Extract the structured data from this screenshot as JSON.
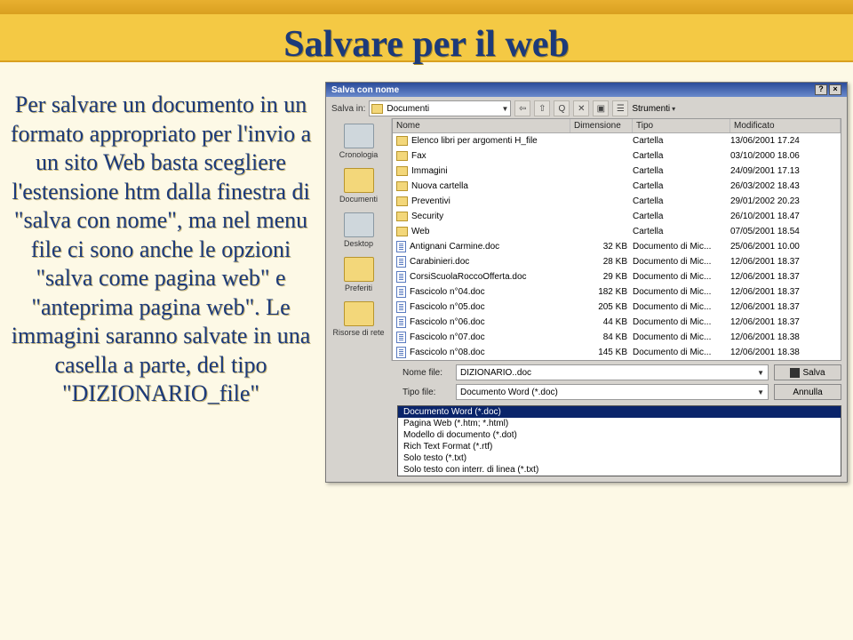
{
  "slide": {
    "title": "Salvare per il web",
    "body": "Per salvare un documento in un formato appropriato per l'invio a un sito Web basta scegliere l'estensione htm dalla finestra di \"salva con nome\", ma nel menu file ci sono anche le opzioni \"salva come pagina web\" e \"anteprima pagina web\". Le immagini saranno salvate in una casella a parte, del tipo \"DIZIONARIO_file\""
  },
  "dialog": {
    "title": "Salva con nome",
    "salva_in_label": "Salva in:",
    "salva_in_value": "Documenti",
    "strumenti": "Strumenti",
    "places": [
      {
        "name": "cronologia",
        "label": "Cronologia",
        "gray": true
      },
      {
        "name": "documenti",
        "label": "Documenti"
      },
      {
        "name": "desktop",
        "label": "Desktop",
        "gray": true
      },
      {
        "name": "preferiti",
        "label": "Preferiti"
      },
      {
        "name": "risorse",
        "label": "Risorse di rete"
      }
    ],
    "columns": {
      "name": "Nome",
      "size": "Dimensione",
      "type": "Tipo",
      "mod": "Modificato"
    },
    "files": [
      {
        "kind": "folder",
        "name": "Elenco libri per argomenti H_file",
        "size": "",
        "type": "Cartella",
        "mod": "13/06/2001 17.24"
      },
      {
        "kind": "folder",
        "name": "Fax",
        "size": "",
        "type": "Cartella",
        "mod": "03/10/2000 18.06"
      },
      {
        "kind": "folder",
        "name": "Immagini",
        "size": "",
        "type": "Cartella",
        "mod": "24/09/2001 17.13"
      },
      {
        "kind": "folder",
        "name": "Nuova cartella",
        "size": "",
        "type": "Cartella",
        "mod": "26/03/2002 18.43"
      },
      {
        "kind": "folder",
        "name": "Preventivi",
        "size": "",
        "type": "Cartella",
        "mod": "29/01/2002 20.23"
      },
      {
        "kind": "folder",
        "name": "Security",
        "size": "",
        "type": "Cartella",
        "mod": "26/10/2001 18.47"
      },
      {
        "kind": "folder",
        "name": "Web",
        "size": "",
        "type": "Cartella",
        "mod": "07/05/2001 18.54"
      },
      {
        "kind": "doc",
        "name": "Antignani Carmine.doc",
        "size": "32 KB",
        "type": "Documento di Mic...",
        "mod": "25/06/2001 10.00"
      },
      {
        "kind": "doc",
        "name": "Carabinieri.doc",
        "size": "28 KB",
        "type": "Documento di Mic...",
        "mod": "12/06/2001 18.37"
      },
      {
        "kind": "doc",
        "name": "CorsiScuolaRoccoOfferta.doc",
        "size": "29 KB",
        "type": "Documento di Mic...",
        "mod": "12/06/2001 18.37"
      },
      {
        "kind": "doc",
        "name": "Fascicolo n°04.doc",
        "size": "182 KB",
        "type": "Documento di Mic...",
        "mod": "12/06/2001 18.37"
      },
      {
        "kind": "doc",
        "name": "Fascicolo n°05.doc",
        "size": "205 KB",
        "type": "Documento di Mic...",
        "mod": "12/06/2001 18.37"
      },
      {
        "kind": "doc",
        "name": "Fascicolo n°06.doc",
        "size": "44 KB",
        "type": "Documento di Mic...",
        "mod": "12/06/2001 18.37"
      },
      {
        "kind": "doc",
        "name": "Fascicolo n°07.doc",
        "size": "84 KB",
        "type": "Documento di Mic...",
        "mod": "12/06/2001 18.38"
      },
      {
        "kind": "doc",
        "name": "Fascicolo n°08.doc",
        "size": "145 KB",
        "type": "Documento di Mic...",
        "mod": "12/06/2001 18.38"
      }
    ],
    "nome_file_label": "Nome file:",
    "nome_file_value": "DIZIONARIO..doc",
    "tipo_file_label": "Tipo file:",
    "tipo_file_value": "Documento Word (*.doc)",
    "save_label": "Salva",
    "cancel_label": "Annulla",
    "type_options": [
      "Documento Word (*.doc)",
      "Pagina Web (*.htm; *.html)",
      "Modello di documento (*.dot)",
      "Rich Text Format (*.rtf)",
      "Solo testo (*.txt)",
      "Solo testo con interr. di linea (*.txt)"
    ]
  }
}
